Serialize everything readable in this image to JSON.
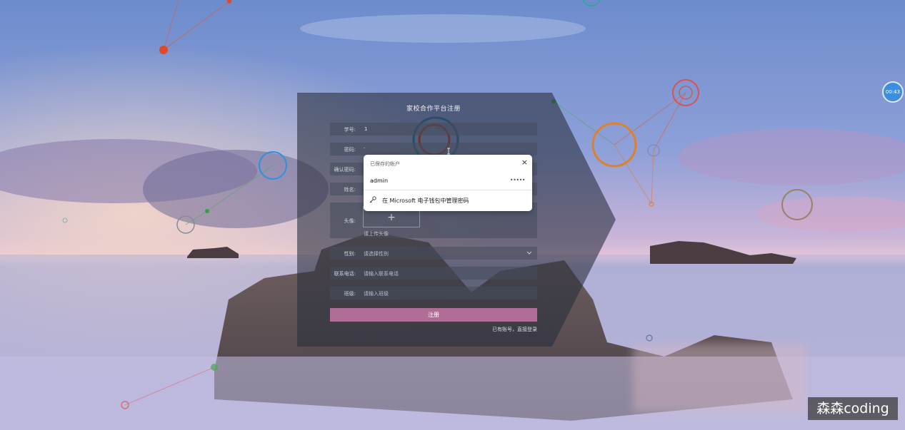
{
  "form": {
    "title": "家校合作平台注册",
    "fields": [
      {
        "label": "学号:",
        "value": "1",
        "placeholder": ""
      },
      {
        "label": "密码:",
        "value": "·",
        "placeholder": ""
      },
      {
        "label": "确认密码:",
        "value": "",
        "placeholder": ""
      },
      {
        "label": "姓名:",
        "value": "",
        "placeholder": ""
      },
      {
        "label": "头像:",
        "value": "",
        "placeholder": "+"
      },
      {
        "label": "性别:",
        "value": "",
        "placeholder": "请选择性别"
      },
      {
        "label": "联系电话:",
        "value": "",
        "placeholder": "请输入联系电话"
      },
      {
        "label": "班级:",
        "value": "",
        "placeholder": "请输入班级"
      }
    ],
    "upload_hint": "请上传头像",
    "submit_label": "注册",
    "login_link": "已有账号，直接登录"
  },
  "saved_accounts_popup": {
    "header": "已保存的帐户",
    "close": "×",
    "account": "admin",
    "masked_password": "•••••",
    "manage_label": "在 Microsoft 电子钱包中管理密码"
  },
  "timer": "00:43",
  "watermark": "森森coding",
  "colors": {
    "button": "#b06d95",
    "timer": "#3c8fe0"
  }
}
